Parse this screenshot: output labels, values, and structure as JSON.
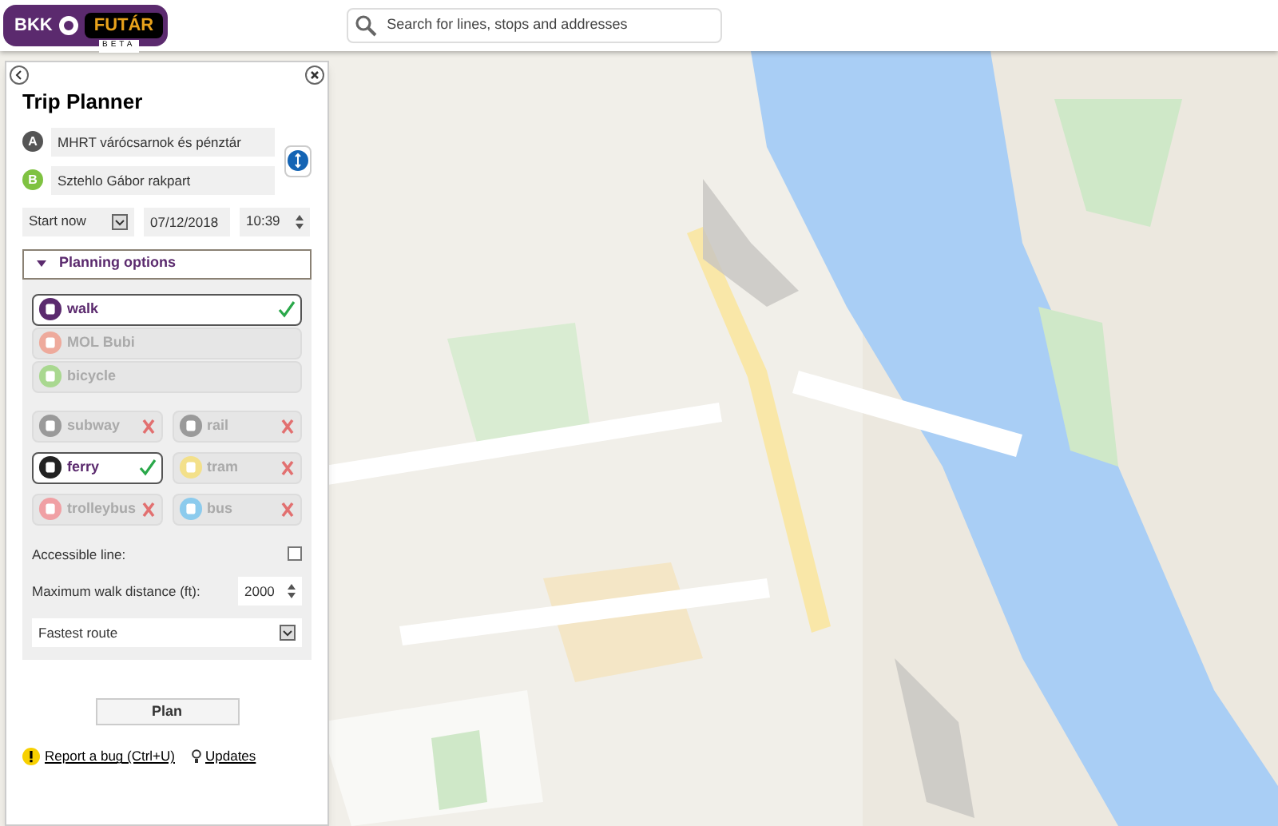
{
  "header": {
    "logo": {
      "left": "BKK",
      "right": "FUTÁR",
      "sub": "BETA"
    },
    "search": {
      "placeholder": "Search for lines, stops and addresses"
    }
  },
  "trip_planner": {
    "title": "Trip Planner",
    "from": {
      "marker": "A",
      "value": "MHRT várócsarnok és pénztár"
    },
    "to": {
      "marker": "B",
      "value": "Sztehlo Gábor rakpart"
    },
    "time_mode": "Start now",
    "date": "07/12/2018",
    "time": "10:39",
    "planning_options": {
      "label": "Planning options",
      "expanded": true,
      "modes": [
        {
          "label": "walk",
          "color": "#5b2a6e",
          "selected": true
        },
        {
          "label": "MOL Bubi",
          "color": "#eeaa9c",
          "selected": false
        },
        {
          "label": "bicycle",
          "color": "#a9d890",
          "selected": false
        }
      ],
      "transit": [
        {
          "label": "subway",
          "color": "#9a9a9a",
          "selected": false
        },
        {
          "label": "rail",
          "color": "#9a9a9a",
          "selected": false
        },
        {
          "label": "ferry",
          "color": "#222222",
          "selected": true
        },
        {
          "label": "tram",
          "color": "#f3e08a",
          "selected": false
        },
        {
          "label": "trolleybus",
          "color": "#f0a0a4",
          "selected": false
        },
        {
          "label": "bus",
          "color": "#8ccbed",
          "selected": false
        }
      ],
      "accessible": {
        "label": "Accessible line:",
        "checked": false
      },
      "walk_distance": {
        "label": "Maximum walk distance (ft):",
        "value": "2000"
      },
      "route_type": "Fastest route"
    },
    "plan_button": "Plan",
    "links": [
      {
        "label": "Report a bug (Ctrl+U)",
        "kind": "bug"
      },
      {
        "label": "Updates",
        "kind": "updates"
      }
    ]
  }
}
